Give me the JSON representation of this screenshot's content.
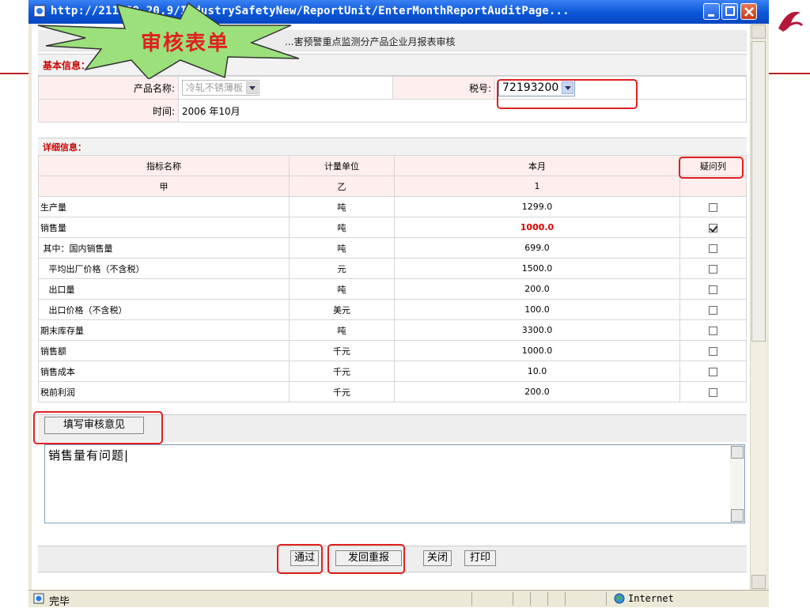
{
  "window": {
    "title": "http://211.88.20.9/IndustrySafetyNew/ReportUnit/EnterMonthReportAuditPage..."
  },
  "callout": "审核表单",
  "page": {
    "header_title": "...害预警重点监测分产品企业月报表审核",
    "basic_info": {
      "section_label": "基本信息：",
      "product_label": "产品名称:",
      "product_value": "冷轧不锈薄板",
      "tax_label": "税号:",
      "tax_value": "72193200",
      "time_label": "时间:",
      "time_value": "2006 年10月"
    },
    "details": {
      "section_label": "详细信息：",
      "columns": [
        "指标名称",
        "计量单位",
        "本月",
        "疑问列"
      ],
      "index_row": [
        "甲",
        "乙",
        "1",
        ""
      ],
      "rows": [
        {
          "name": "生产量",
          "unit": "吨",
          "value": "1299.0",
          "checked": false
        },
        {
          "name": "销售量",
          "unit": "吨",
          "value": "1000.0",
          "checked": true,
          "flagged": true
        },
        {
          "name": " 其中：国内销售量",
          "unit": "吨",
          "value": "699.0",
          "checked": false
        },
        {
          "name": "   平均出厂价格（不含税）",
          "unit": "元",
          "value": "1500.0",
          "checked": false
        },
        {
          "name": "   出口量",
          "unit": "吨",
          "value": "200.0",
          "checked": false
        },
        {
          "name": "   出口价格（不含税）",
          "unit": "美元",
          "value": "100.0",
          "checked": false
        },
        {
          "name": "期末库存量",
          "unit": "吨",
          "value": "3300.0",
          "checked": false
        },
        {
          "name": "销售额",
          "unit": "千元",
          "value": "1000.0",
          "checked": false
        },
        {
          "name": "销售成本",
          "unit": "千元",
          "value": "10.0",
          "checked": false
        },
        {
          "name": "税前利润",
          "unit": "千元",
          "value": "200.0",
          "checked": false
        }
      ]
    },
    "opinion": {
      "button_label": "填写审核意见",
      "text": "销售量有问题|"
    },
    "actions": {
      "approve": "通过",
      "return": "发回重报",
      "close": "关闭",
      "print": "打印"
    }
  },
  "statusbar": {
    "status": "完毕",
    "zone": "Internet"
  }
}
